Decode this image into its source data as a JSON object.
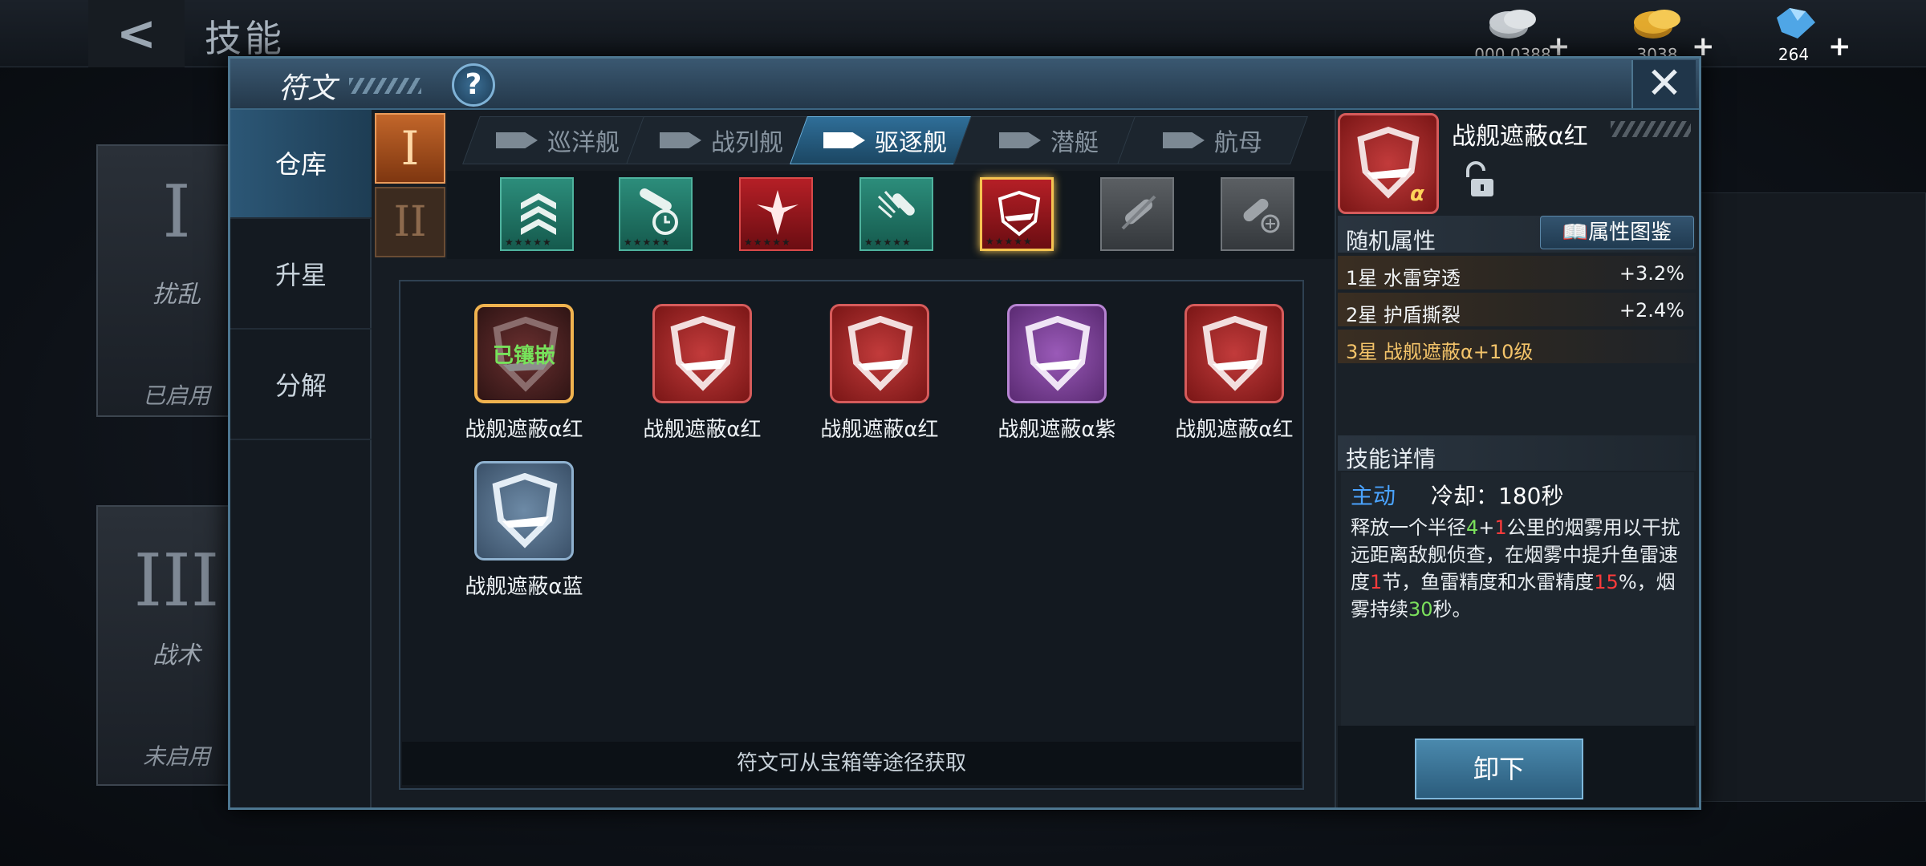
{
  "top_bar": {
    "back_label": "<",
    "title": "技能",
    "resources": [
      {
        "icon": "silver-coins-icon",
        "value": "000 0388"
      },
      {
        "icon": "gold-coins-icon",
        "value": "3038"
      },
      {
        "icon": "diamond-icon",
        "value": "264"
      }
    ],
    "plus": "+"
  },
  "background_cards": [
    {
      "roman": "I",
      "subtitle": "扰乱",
      "status": "已启用"
    },
    {
      "roman": "III",
      "subtitle": "战术",
      "status": "未启用"
    }
  ],
  "dialog": {
    "title": "符文",
    "help": "?",
    "close": "✕",
    "side_tabs": [
      {
        "label": "仓库",
        "active": true
      },
      {
        "label": "升星",
        "active": false
      },
      {
        "label": "分解",
        "active": false
      }
    ],
    "tiers": [
      "I",
      "II"
    ],
    "ship_tabs": [
      {
        "label": "巡洋舰",
        "active": false
      },
      {
        "label": "战列舰",
        "active": false
      },
      {
        "label": "驱逐舰",
        "active": true
      },
      {
        "label": "潜艇",
        "active": false
      },
      {
        "label": "航母",
        "active": false
      }
    ],
    "skill_icons": [
      {
        "icon": "chevron-rank-icon",
        "color": "teal"
      },
      {
        "icon": "torpedo-clock-icon",
        "color": "teal"
      },
      {
        "icon": "burst-icon",
        "color": "red"
      },
      {
        "icon": "torpedo-spray-icon",
        "color": "teal"
      },
      {
        "icon": "ship-shield-icon",
        "color": "red",
        "selected": true
      },
      {
        "icon": "locked-torpedo-icon",
        "color": "grey"
      },
      {
        "icon": "locked-torpedo-target-icon",
        "color": "grey"
      }
    ],
    "runes": [
      {
        "name": "战舰遮蔽α红",
        "color": "equipped",
        "tag": "已镶嵌"
      },
      {
        "name": "战舰遮蔽α红",
        "color": "red",
        "tag": ""
      },
      {
        "name": "战舰遮蔽α红",
        "color": "red",
        "tag": ""
      },
      {
        "name": "战舰遮蔽α紫",
        "color": "purple",
        "tag": ""
      },
      {
        "name": "战舰遮蔽α红",
        "color": "red",
        "tag": ""
      },
      {
        "name": "战舰遮蔽α蓝",
        "color": "blue",
        "tag": ""
      }
    ],
    "source_hint": "符文可从宝箱等途径获取",
    "detail": {
      "name": "战舰遮蔽α红",
      "alpha": "α",
      "random_attr_title": "随机属性",
      "atlas_button": "属性图鉴",
      "attributes": [
        {
          "label": "1星 水雷穿透",
          "value": "+3.2%"
        },
        {
          "label": "2星 护盾撕裂",
          "value": "+2.4%"
        },
        {
          "label": "3星 战舰遮蔽α+10级",
          "value": ""
        }
      ],
      "skill_title": "技能详情",
      "skill_type": "主动",
      "cooldown": "冷却：180秒",
      "desc_parts": {
        "p1": "释放一个半径",
        "n1": "4",
        "plus": "+",
        "n2": "1",
        "p2": "公里的烟雾用以干扰远距离敌舰侦查，在烟雾中提升鱼雷速度",
        "n3": "1",
        "p3": "节，鱼雷精度和水雷精度",
        "n4": "15",
        "p4": "%，烟雾持续",
        "n5": "30",
        "p5": "秒。"
      },
      "unequip_button": "卸下"
    }
  },
  "colors": {
    "accent": "#2f6e98",
    "equipped_border": "#f0b34f",
    "equipped_tag": "#77e25b",
    "active_skill": "#4aa3ff"
  }
}
